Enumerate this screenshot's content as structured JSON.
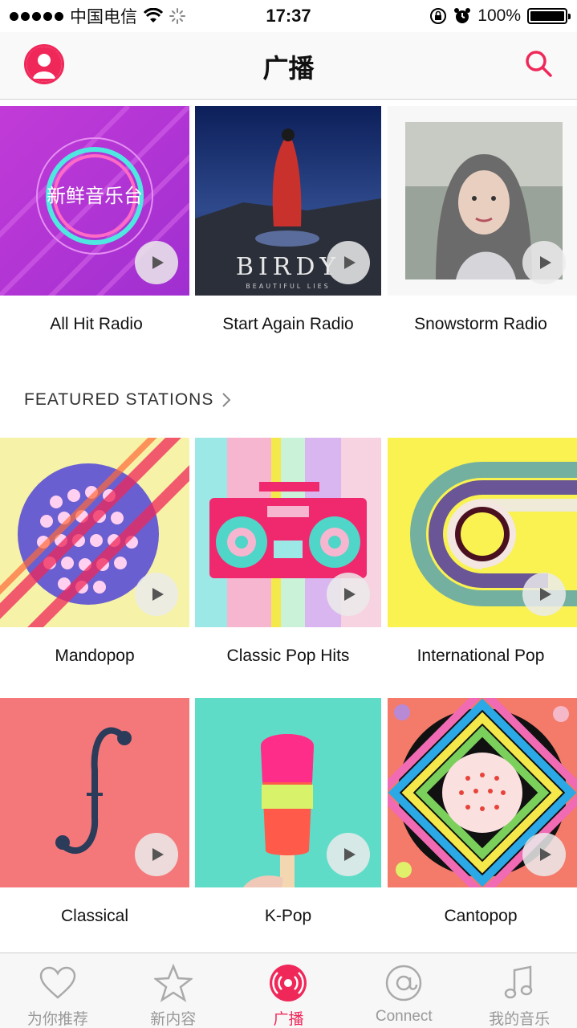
{
  "status": {
    "carrier": "中国电信",
    "time": "17:37",
    "battery_text": "100%",
    "battery_level": 1.0
  },
  "nav": {
    "title": "广播",
    "profile_icon": "person-icon",
    "search_icon": "search-icon"
  },
  "top_stations": [
    {
      "label": "All Hit Radio",
      "art_text": "新鲜音乐台"
    },
    {
      "label": "Start Again Radio",
      "art_text": "BIRDY",
      "art_subtext": "BEAUTIFUL LIES"
    },
    {
      "label": "Snowstorm Radio"
    }
  ],
  "featured": {
    "header": "FEATURED STATIONS",
    "stations": [
      {
        "label": "Mandopop"
      },
      {
        "label": "Classic Pop Hits"
      },
      {
        "label": "International Pop"
      },
      {
        "label": "Classical"
      },
      {
        "label": "K-Pop"
      },
      {
        "label": "Cantopop"
      }
    ]
  },
  "tabs": [
    {
      "label": "为你推荐",
      "icon": "heart-icon"
    },
    {
      "label": "新内容",
      "icon": "star-icon"
    },
    {
      "label": "广播",
      "icon": "radio-icon",
      "active": true
    },
    {
      "label": "Connect",
      "icon": "at-icon"
    },
    {
      "label": "我的音乐",
      "icon": "music-note-icon"
    }
  ],
  "colors": {
    "accent": "#f0285a"
  }
}
